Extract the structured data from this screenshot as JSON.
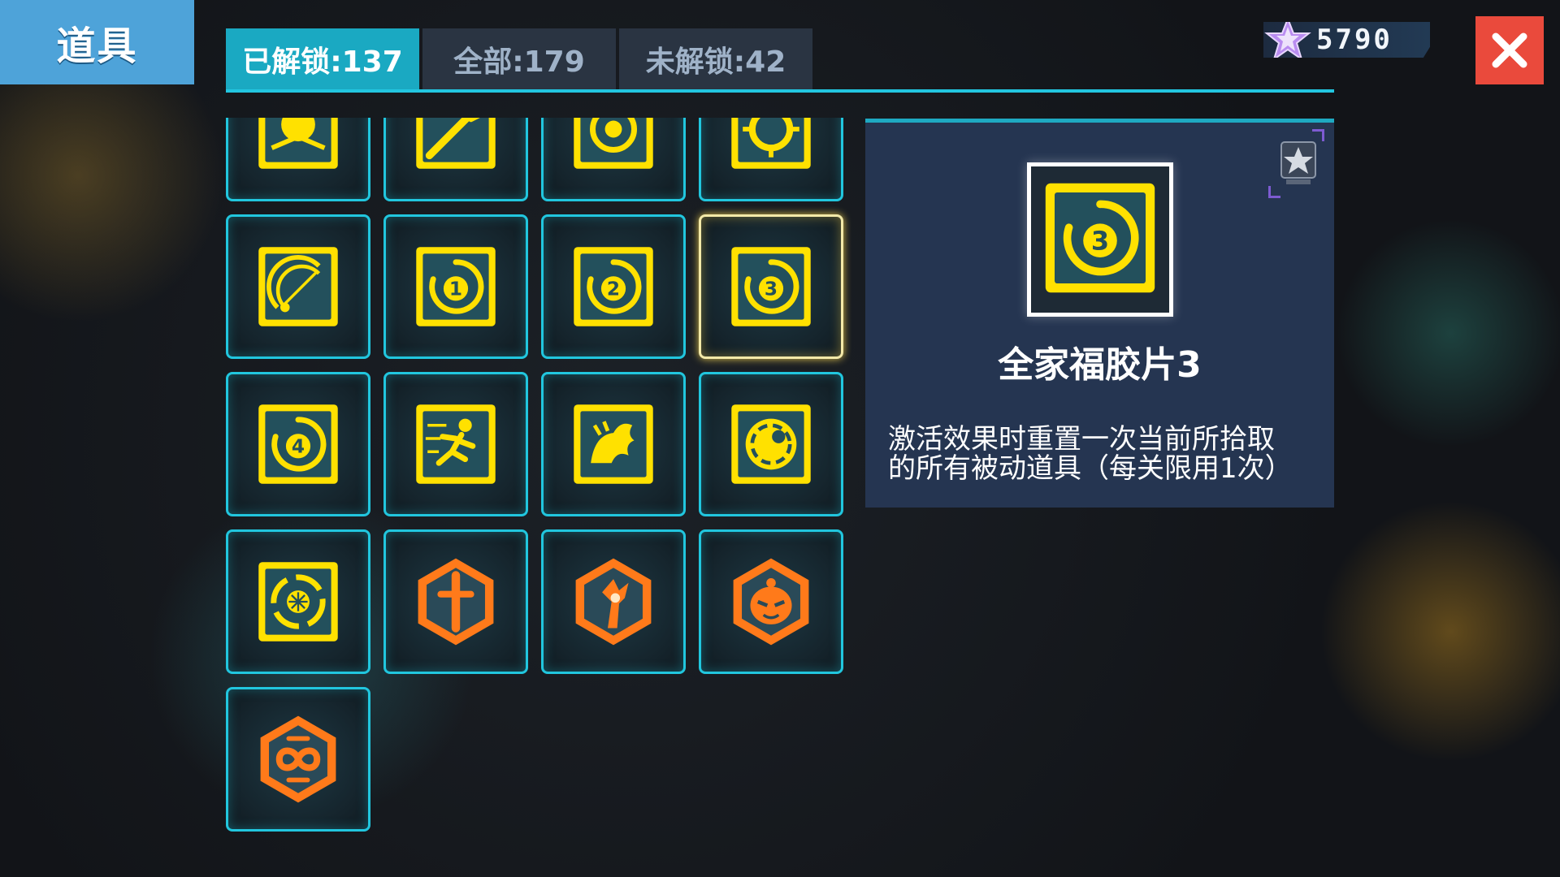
{
  "header": {
    "title": "道具"
  },
  "tabs": [
    {
      "label": "已解锁:137",
      "active": true
    },
    {
      "label": "全部:179",
      "active": false
    },
    {
      "label": "未解锁:42",
      "active": false
    }
  ],
  "currency": {
    "icon": "purple-star-gem-icon",
    "amount": "5790"
  },
  "close": {
    "icon": "close-x-icon"
  },
  "items": [
    {
      "icon": "sun-burst-icon",
      "style": "square-yellow"
    },
    {
      "icon": "feather-slash-icon",
      "style": "square-yellow"
    },
    {
      "icon": "gear-sun-icon",
      "style": "square-yellow"
    },
    {
      "icon": "spiked-ring-icon",
      "style": "square-yellow"
    },
    {
      "icon": "arc-wave-icon",
      "style": "square-yellow"
    },
    {
      "icon": "capsule-1-icon",
      "number": "1",
      "style": "square-yellow"
    },
    {
      "icon": "capsule-2-icon",
      "number": "2",
      "style": "square-yellow"
    },
    {
      "icon": "capsule-3-icon",
      "number": "3",
      "style": "square-yellow",
      "selected": true
    },
    {
      "icon": "capsule-4-icon",
      "number": "4",
      "style": "square-yellow"
    },
    {
      "icon": "running-man-icon",
      "style": "square-yellow"
    },
    {
      "icon": "dragon-icon",
      "style": "square-yellow"
    },
    {
      "icon": "spiral-ball-icon",
      "style": "square-yellow"
    },
    {
      "icon": "snowflake-vortex-icon",
      "style": "square-yellow"
    },
    {
      "icon": "sword-icon",
      "style": "hex-orange"
    },
    {
      "icon": "spiky-fist-icon",
      "style": "hex-orange"
    },
    {
      "icon": "demon-face-icon",
      "style": "hex-orange"
    },
    {
      "icon": "infinity-icon",
      "style": "hex-orange"
    }
  ],
  "detail": {
    "icon": "capsule-3-icon",
    "number": "3",
    "badge_icon": "silver-star-badge-icon",
    "name": "全家福胶片3",
    "description_line1": "激活效果时重置一次当前所拾取",
    "description_line2": "的所有被动道具（每关限用1次）"
  },
  "colors": {
    "accent": "#22c6e0",
    "active_tab": "#1aa9c2",
    "icon_yellow": "#ffe100",
    "icon_orange": "#ff7a1a",
    "close_red": "#ea4a3c",
    "title_blue": "#4ea3d9"
  }
}
